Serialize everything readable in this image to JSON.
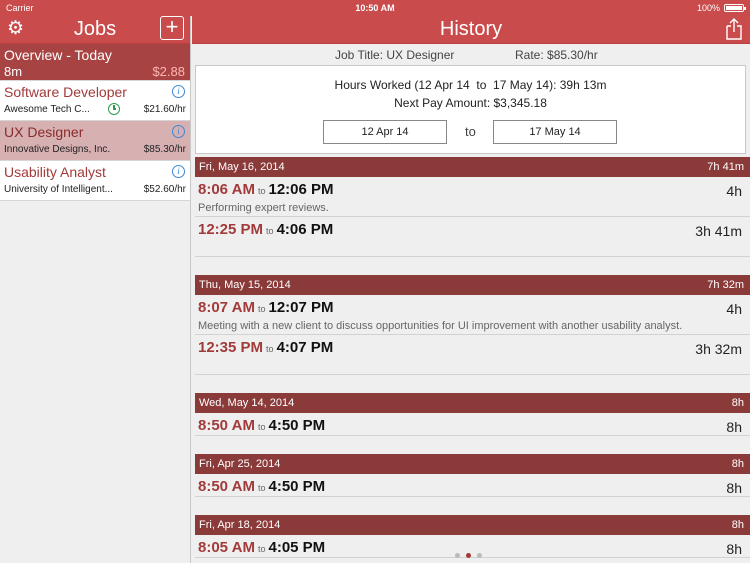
{
  "status": {
    "carrier": "Carrier",
    "time": "10:50 AM",
    "battery": "100%"
  },
  "sidebar": {
    "title": "Jobs",
    "overview": {
      "name": "Overview - Today",
      "duration": "8m",
      "amount": "$2.88"
    },
    "jobs": [
      {
        "name": "Software Developer",
        "company": "Awesome Tech C...",
        "rate": "$21.60/hr"
      },
      {
        "name": "UX Designer",
        "company": "Innovative Designs, Inc.",
        "rate": "$85.30/hr"
      },
      {
        "name": "Usability Analyst",
        "company": "University of Intelligent...",
        "rate": "$52.60/hr"
      }
    ]
  },
  "main": {
    "title": "History",
    "job_title": "Job Title: UX Designer",
    "rate": "Rate: $85.30/hr",
    "hours_worked": "Hours Worked (12 Apr 14  to  17 May 14): 39h 13m",
    "next_pay": "Next Pay Amount: $3,345.18",
    "start_date": "12 Apr 14",
    "range_to": "to",
    "end_date": "17 May 14",
    "to_label": "to"
  },
  "days": [
    {
      "date": "Fri, May 16, 2014",
      "total": "7h 41m",
      "entries": [
        {
          "start": "8:06 AM",
          "end": "12:06 PM",
          "duration": "4h",
          "note": "Performing expert reviews."
        },
        {
          "start": "12:25 PM",
          "end": "4:06 PM",
          "duration": "3h 41m",
          "note": ""
        }
      ]
    },
    {
      "date": "Thu, May 15, 2014",
      "total": "7h 32m",
      "entries": [
        {
          "start": "8:07 AM",
          "end": "12:07 PM",
          "duration": "4h",
          "note": "Meeting with a new client to discuss opportunities for UI improvement with another usability analyst."
        },
        {
          "start": "12:35 PM",
          "end": "4:07 PM",
          "duration": "3h 32m",
          "note": ""
        }
      ]
    },
    {
      "date": "Wed, May 14, 2014",
      "total": "8h",
      "entries": [
        {
          "start": "8:50 AM",
          "end": "4:50 PM",
          "duration": "8h",
          "note": ""
        }
      ]
    },
    {
      "date": "Fri, Apr 25, 2014",
      "total": "8h",
      "entries": [
        {
          "start": "8:50 AM",
          "end": "4:50 PM",
          "duration": "8h",
          "note": ""
        }
      ]
    },
    {
      "date": "Fri, Apr 18, 2014",
      "total": "8h",
      "entries": [
        {
          "start": "8:05 AM",
          "end": "4:05 PM",
          "duration": "8h",
          "note": ""
        }
      ]
    }
  ],
  "pager": {
    "pages": 3,
    "active": 2
  },
  "colors": {
    "header": "#c94b4b",
    "day_header": "#8b3a3a",
    "accent": "#a23a3a"
  }
}
